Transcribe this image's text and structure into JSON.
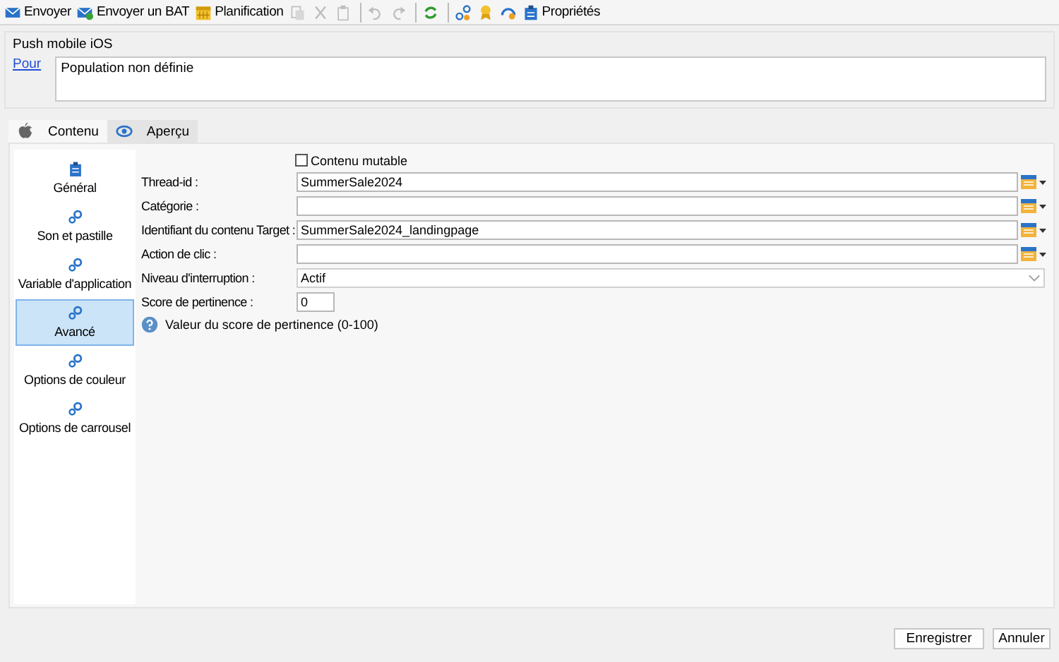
{
  "toolbar": [
    {
      "kind": "send",
      "label": "Envoyer",
      "disabled": false
    },
    {
      "kind": "proof",
      "label": "Envoyer un BAT",
      "disabled": false
    },
    {
      "kind": "schedule",
      "label": "Planification",
      "disabled": false
    },
    {
      "kind": "copy",
      "disabled": true
    },
    {
      "kind": "cut",
      "disabled": true
    },
    {
      "kind": "paste",
      "disabled": true
    },
    {
      "kind": "sep"
    },
    {
      "kind": "undo",
      "disabled": true
    },
    {
      "kind": "redo",
      "disabled": true
    },
    {
      "kind": "sep"
    },
    {
      "kind": "refresh",
      "disabled": false
    },
    {
      "kind": "sep"
    },
    {
      "kind": "link",
      "disabled": false
    },
    {
      "kind": "award",
      "disabled": false
    },
    {
      "kind": "gauge",
      "disabled": false
    },
    {
      "kind": "properties",
      "label": "Propriétés",
      "disabled": false
    }
  ],
  "section_title": "Push mobile iOS",
  "target": {
    "link": "Pour",
    "value": "Population non définie"
  },
  "tabs": [
    {
      "label": "Contenu",
      "kind": "apple",
      "selected": true
    },
    {
      "label": "Aperçu",
      "kind": "eye",
      "selected": false
    }
  ],
  "sidebar": [
    {
      "label": "Général",
      "kind": "clipboard",
      "selected": false
    },
    {
      "label": "Son et pastille",
      "kind": "gears",
      "selected": false
    },
    {
      "label": "Variable d'application",
      "kind": "gears",
      "selected": false
    },
    {
      "label": "Avancé",
      "kind": "gears",
      "selected": true
    },
    {
      "label": "Options de couleur",
      "kind": "gears",
      "selected": false
    },
    {
      "label": "Options de carrousel",
      "kind": "gears",
      "selected": false
    }
  ],
  "mutable": {
    "label": "Contenu mutable",
    "checked": false
  },
  "fields": [
    {
      "kind": "text",
      "label": "Thread-id :",
      "value": "SummerSale2024"
    },
    {
      "kind": "text",
      "label": "Catégorie :"
    },
    {
      "kind": "text",
      "label": "Identifiant du contenu Target :",
      "value": "SummerSale2024_landingpage"
    },
    {
      "kind": "text",
      "label": "Action de clic :"
    },
    {
      "kind": "select",
      "label": "Niveau d'interruption :",
      "value": "Actif"
    },
    {
      "kind": "number",
      "label": "Score de pertinence :",
      "value": "0"
    }
  ],
  "hint": "Valeur du score de pertinence (0-100)",
  "buttons": [
    "Enregistrer",
    "Annuler"
  ]
}
